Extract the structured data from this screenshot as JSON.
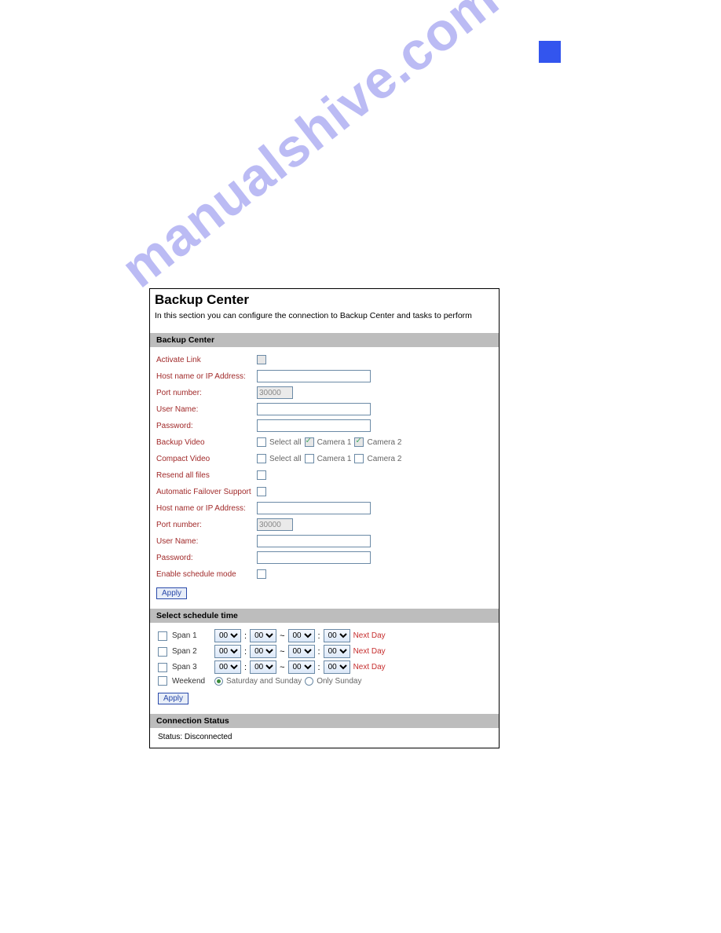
{
  "watermark": "manualshive.com",
  "page_title": "Backup Center",
  "intro": "In this section you can configure the connection to Backup Center and tasks to perform",
  "section1": {
    "header": "Backup Center",
    "fields": {
      "activate_link": "Activate Link",
      "host1": "Host name or IP Address:",
      "port1_label": "Port number:",
      "port1_value": "30000",
      "user1": "User Name:",
      "pass1": "Password:",
      "backup_video": "Backup Video",
      "compact_video": "Compact Video",
      "resend": "Resend all files",
      "failover": "Automatic Failover Support",
      "host2": "Host name or IP Address:",
      "port2_label": "Port number:",
      "port2_value": "30000",
      "user2": "User Name:",
      "pass2": "Password:",
      "enable_sched": "Enable schedule mode",
      "select_all": "Select all",
      "camera1": "Camera 1",
      "camera2": "Camera 2"
    },
    "apply": "Apply"
  },
  "section2": {
    "header": "Select schedule time",
    "span1": "Span 1",
    "span2": "Span 2",
    "span3": "Span 3",
    "weekend": "Weekend",
    "sat_sun": "Saturday and Sunday",
    "only_sun": "Only Sunday",
    "time_val": "00",
    "nextday": "Next Day",
    "apply": "Apply"
  },
  "section3": {
    "header": "Connection Status",
    "status": "Status: Disconnected"
  }
}
